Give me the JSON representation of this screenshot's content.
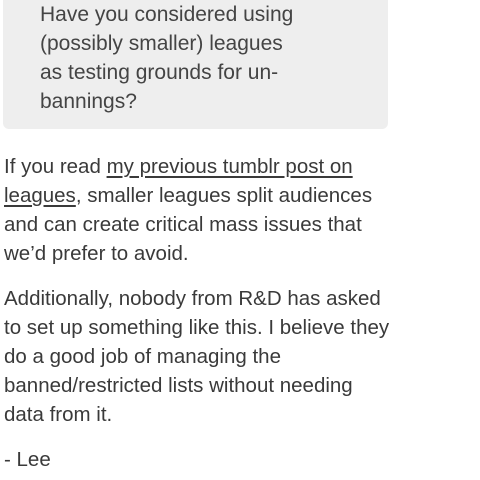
{
  "ask": {
    "text": "Have you considered using\n(possibly smaller) leagues\nas testing grounds for un-\nbannings?"
  },
  "answer": {
    "para1_prefix": "If you read ",
    "para1_link": "my previous tumblr post on\nleagues",
    "para1_suffix": ", smaller leagues split audiences\nand can create critical mass issues that\nwe’d prefer to avoid.",
    "para2": "Additionally, nobody from R&D has asked\nto set up something like this. I believe they\ndo a good job of managing the\nbanned/restricted lists without needing\ndata from it.",
    "signature": "- Lee"
  }
}
